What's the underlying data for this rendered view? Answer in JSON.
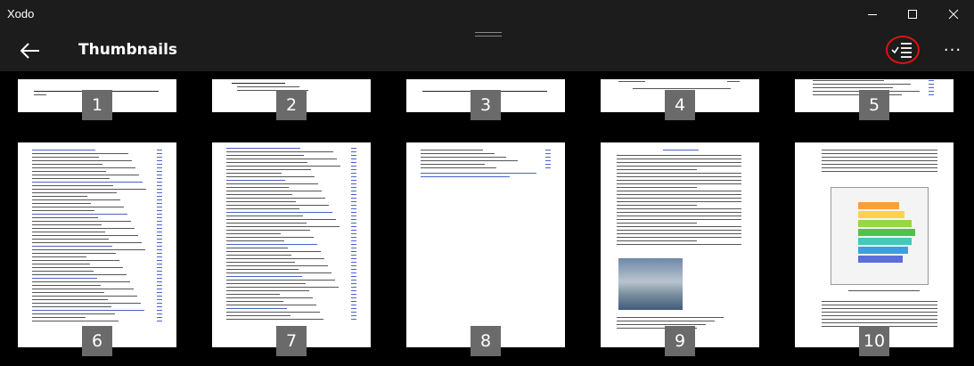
{
  "window": {
    "title": "Xodo"
  },
  "header": {
    "title": "Thumbnails"
  },
  "icons": {
    "back": "back-arrow-icon",
    "select": "multi-select-icon",
    "more": "more-icon",
    "minimize": "minimize-icon",
    "maximize": "maximize-icon",
    "close": "close-icon"
  },
  "highlight_color": "#e01010",
  "thumbnails": [
    {
      "page": "1"
    },
    {
      "page": "2"
    },
    {
      "page": "3"
    },
    {
      "page": "4"
    },
    {
      "page": "5"
    },
    {
      "page": "6"
    },
    {
      "page": "7"
    },
    {
      "page": "8"
    },
    {
      "page": "9"
    },
    {
      "page": "10"
    }
  ]
}
